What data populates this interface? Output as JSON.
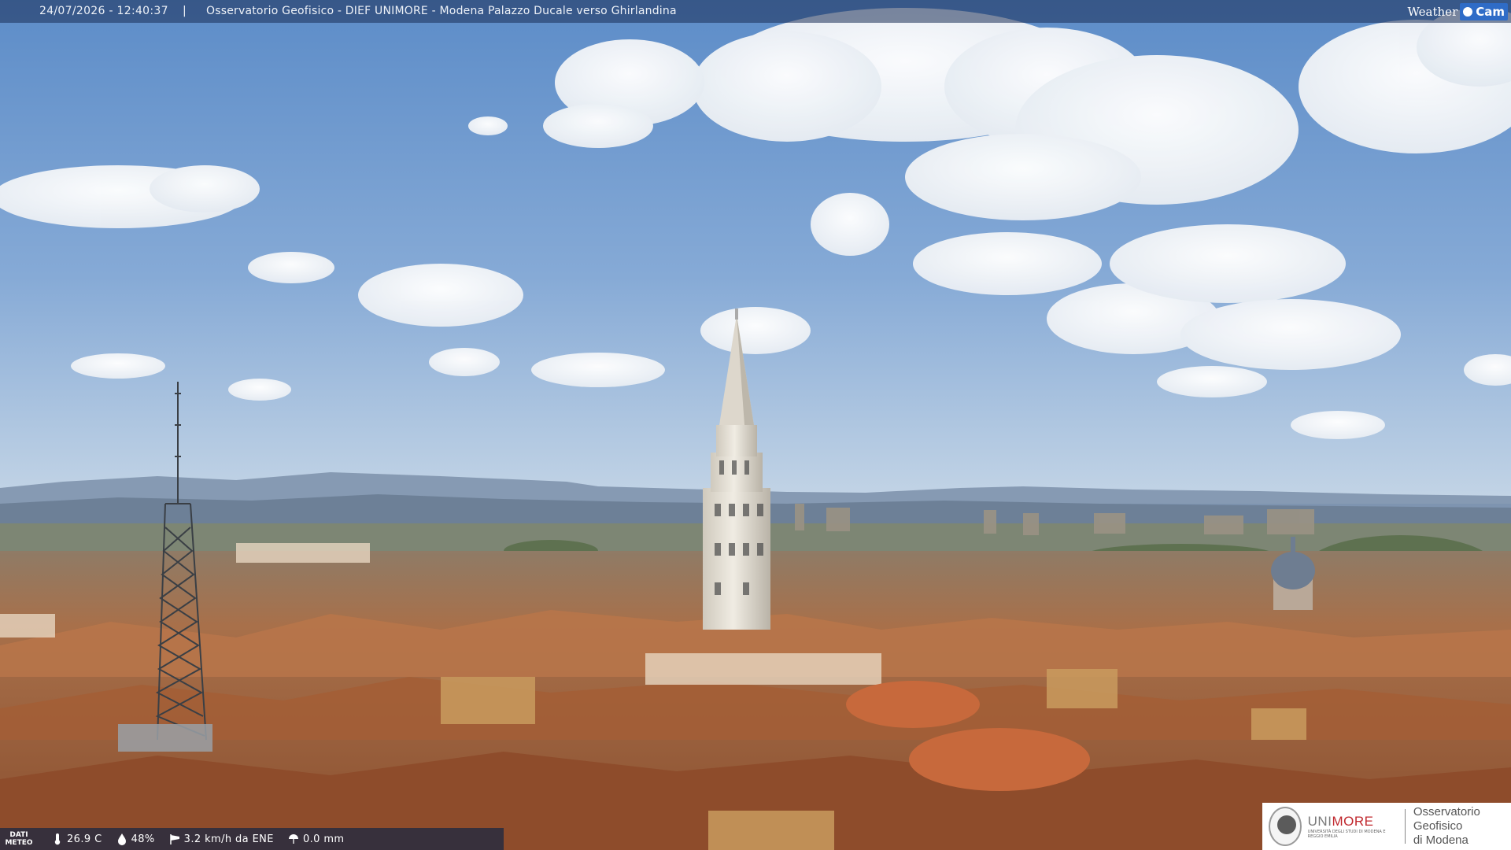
{
  "header": {
    "timestamp": "24/07/2026 - 12:40:37",
    "separator": "|",
    "title": "Osservatorio Geofisico - DIEF UNIMORE - Modena Palazzo Ducale verso Ghirlandina"
  },
  "brand": {
    "word": "Weather",
    "badge": "Cam"
  },
  "weather": {
    "label_line1": "DATI",
    "label_line2": "METEO",
    "temperature": "26.9 C",
    "humidity": "48%",
    "wind": "3.2 km/h da ENE",
    "rain": "0.0 mm",
    "icons": {
      "temperature": "thermometer-icon",
      "humidity": "droplet-icon",
      "wind": "windsock-icon",
      "rain": "rain-icon"
    }
  },
  "logo": {
    "uni_part1": "UNI",
    "uni_part2": "MORE",
    "uni_sub": "UNIVERSITÀ DEGLI STUDI DI MODENA E REGGIO EMILIA",
    "obs_line1": "Osservatorio Geofisico",
    "obs_line2": "di Modena"
  },
  "colors": {
    "sky_top": "#5f8dc7",
    "sky_horizon": "#b7cde3",
    "roof": "#a5643c",
    "tower": "#e6e1d6",
    "brand_blue": "#2f6cc7",
    "unimore_red": "#c0272d"
  }
}
